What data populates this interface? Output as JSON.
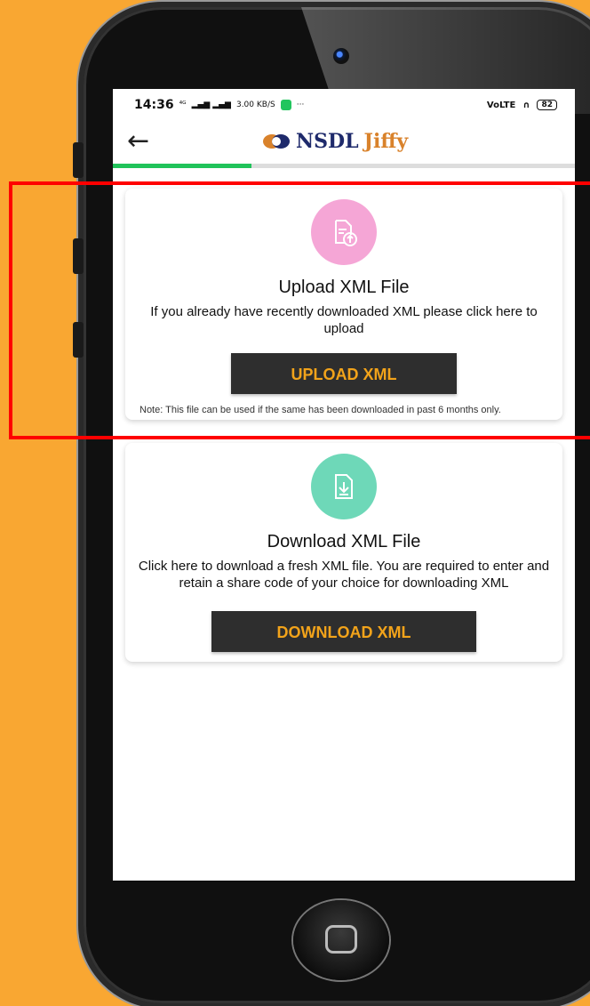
{
  "status_bar": {
    "time": "14:36",
    "signal_text": "⁴ᴳ",
    "speed_value": "3.00",
    "speed_unit": "KB/S",
    "more": "···",
    "network": "VoLTE",
    "battery": "82"
  },
  "app_bar": {
    "back_icon": "arrow-left-icon",
    "brand_name": "NSDL",
    "brand_sub": "Jiffy"
  },
  "progress": {
    "fraction": 0.3
  },
  "upload_card": {
    "icon": "upload-file-icon",
    "icon_bg": "#F5A6D6",
    "title": "Upload XML File",
    "description": "If you already have recently downloaded XML please click here to upload",
    "button_label": "UPLOAD XML",
    "note": "Note:  This file can be used if the same has been downloaded in past 6 months only."
  },
  "download_card": {
    "icon": "download-file-icon",
    "icon_bg": "#6ED8B8",
    "title": "Download XML File",
    "description": "Click here to download a fresh XML file. You are required to enter and retain a share code of your choice for downloading XML",
    "button_label": "DOWNLOAD XML"
  },
  "colors": {
    "background": "#F9A732",
    "button_bg": "#2E2E2E",
    "button_text": "#F2A31A",
    "progress": "#20C35A",
    "highlight": "#FF0000"
  }
}
